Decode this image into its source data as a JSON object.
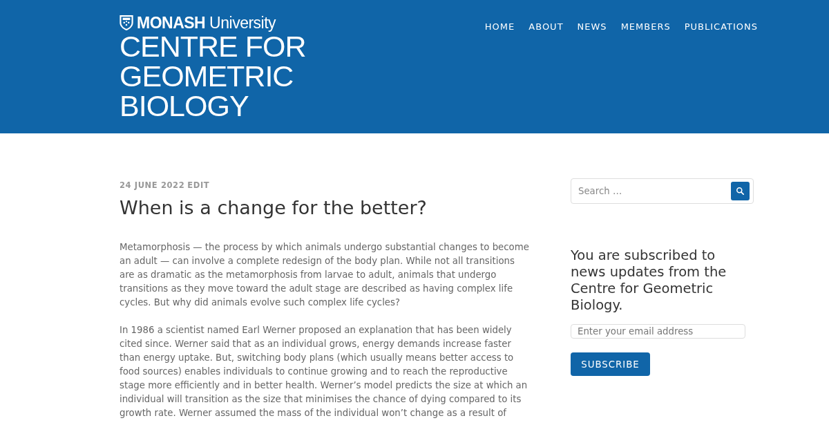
{
  "header": {
    "logo": {
      "university": "**MONASH** University",
      "title_lines": [
        "CENTRE FOR",
        "GEOMETRIC",
        "BIOLOGY"
      ]
    },
    "nav": [
      {
        "label": "HOME"
      },
      {
        "label": "ABOUT"
      },
      {
        "label": "NEWS"
      },
      {
        "label": "MEMBERS"
      },
      {
        "label": "PUBLICATIONS"
      }
    ]
  },
  "post": {
    "date": "24 JUNE 2022",
    "edit": "EDIT",
    "title": "When is a change for the better?",
    "paragraphs": [
      "Metamorphosis — the process by which animals undergo substantial changes to become an adult — can involve a complete redesign of the body plan. While not all transitions are as dramatic as the metamorphosis from larvae to adult, animals that undergo transitions as they move toward the adult stage are described as having complex life cycles. But why did animals evolve such complex life cycles?",
      "In 1986 a scientist named Earl Werner proposed an explanation that has been widely cited since. Werner said that as an individual grows, energy demands increase faster than energy uptake. But, switching body plans (which usually means better access to food sources) enables individuals to continue growing and to reach the reproductive stage more efficiently and in better health. Werner’s model predicts the size at which an individual will transition as the size that minimises the chance of dying compared to its growth rate. Werner assumed the mass of the individual won’t change as a result of"
    ]
  },
  "sidebar": {
    "search": {
      "placeholder": "Search …"
    },
    "subscribe": {
      "heading": "You are subscribed to news updates from the Centre for Geometric Biology.",
      "email_placeholder": "Enter your email address",
      "button": "SUBSCRIBE"
    }
  }
}
